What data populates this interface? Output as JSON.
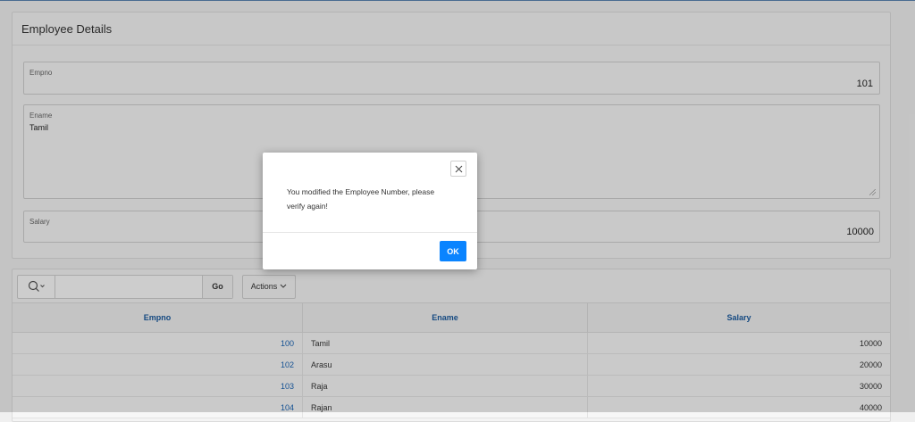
{
  "form": {
    "title": "Employee Details",
    "empno": {
      "label": "Empno",
      "value": "101"
    },
    "ename": {
      "label": "Ename",
      "value": "Tamil"
    },
    "salary": {
      "label": "Salary",
      "value": "10000"
    }
  },
  "report": {
    "search": {
      "value": "",
      "go_label": "Go"
    },
    "actions_label": "Actions",
    "columns": [
      "Empno",
      "Ename",
      "Salary"
    ],
    "rows": [
      {
        "empno": "100",
        "ename": "Tamil",
        "salary": "10000"
      },
      {
        "empno": "102",
        "ename": "Arasu",
        "salary": "20000"
      },
      {
        "empno": "103",
        "ename": "Raja",
        "salary": "30000"
      },
      {
        "empno": "104",
        "ename": "Rajan",
        "salary": "40000"
      }
    ]
  },
  "dialog": {
    "message": "You modified the Employee Number, please verify again!",
    "ok_label": "OK",
    "close_icon": "close-icon"
  },
  "colors": {
    "accent": "#0a84ff",
    "link": "#1a64b4",
    "header_text": "#1a5a9e"
  }
}
